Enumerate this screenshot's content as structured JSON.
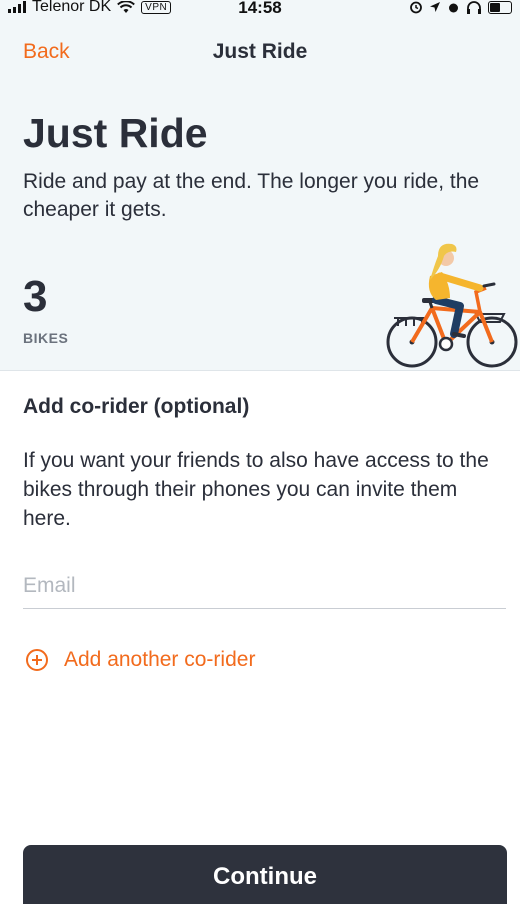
{
  "status_bar": {
    "carrier": "Telenor DK",
    "vpn": "VPN",
    "time": "14:58"
  },
  "nav": {
    "back_label": "Back",
    "title": "Just Ride"
  },
  "hero": {
    "title": "Just Ride",
    "subtitle": "Ride and pay at the end. The longer you ride, the cheaper it gets.",
    "bike_count": "3",
    "bike_label": "BIKES"
  },
  "co_rider": {
    "heading": "Add co-rider (optional)",
    "description": "If you want your friends to also have access to the bikes through their phones you can invite them here.",
    "email_placeholder": "Email",
    "email_value": "",
    "add_another_label": "Add another co-rider"
  },
  "footer": {
    "continue_label": "Continue"
  },
  "colors": {
    "accent": "#f26b1d",
    "dark": "#2e323d",
    "header_bg": "#f2f7f9"
  },
  "icons": [
    "signal-icon",
    "wifi-icon",
    "location-icon",
    "alarm-icon",
    "headphones-icon",
    "battery-icon",
    "plus-circle-icon",
    "bike-rider-illustration"
  ]
}
